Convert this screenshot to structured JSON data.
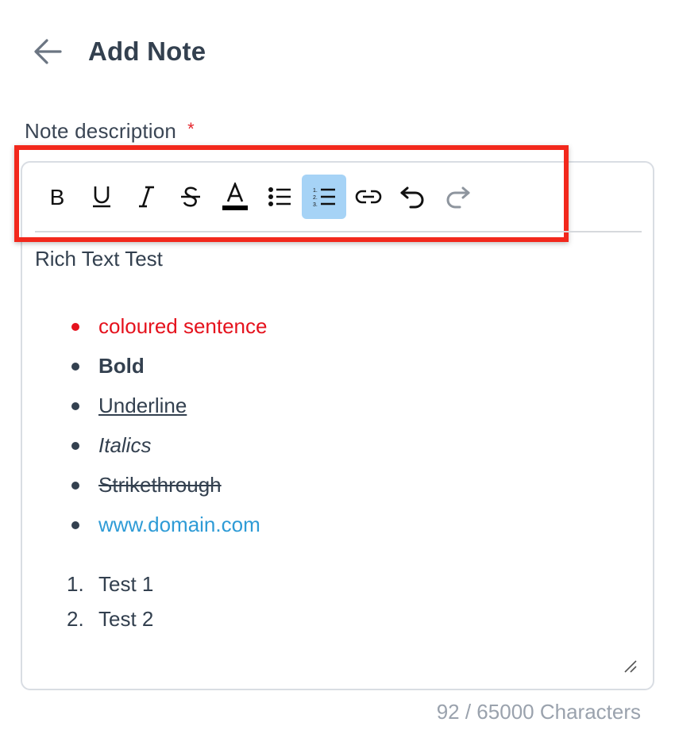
{
  "header": {
    "title": "Add Note",
    "back_icon": "arrow-left-icon"
  },
  "field": {
    "label": "Note description",
    "required_mark": "*"
  },
  "toolbar": {
    "buttons": [
      {
        "name": "bold",
        "icon": "bold-icon",
        "active": false,
        "enabled": true,
        "glyph": "B"
      },
      {
        "name": "underline",
        "icon": "underline-icon",
        "active": false,
        "enabled": true,
        "glyph": "U"
      },
      {
        "name": "italic",
        "icon": "italic-icon",
        "active": false,
        "enabled": true,
        "glyph": "I"
      },
      {
        "name": "strikethrough",
        "icon": "strikethrough-icon",
        "active": false,
        "enabled": true,
        "glyph": "S"
      },
      {
        "name": "text-color",
        "icon": "text-color-icon",
        "active": false,
        "enabled": true,
        "glyph": "A"
      },
      {
        "name": "bullet-list",
        "icon": "bullet-list-icon",
        "active": false,
        "enabled": true
      },
      {
        "name": "numbered-list",
        "icon": "numbered-list-icon",
        "active": true,
        "enabled": true
      },
      {
        "name": "link",
        "icon": "link-icon",
        "active": false,
        "enabled": true
      },
      {
        "name": "undo",
        "icon": "undo-icon",
        "active": false,
        "enabled": true
      },
      {
        "name": "redo",
        "icon": "redo-icon",
        "active": false,
        "enabled": false
      }
    ]
  },
  "content": {
    "intro": "Rich Text Test",
    "bullets": [
      {
        "text": "coloured sentence",
        "style": "red"
      },
      {
        "text": "Bold",
        "style": "bold"
      },
      {
        "text": "Underline",
        "style": "underline"
      },
      {
        "text": "Italics",
        "style": "italic"
      },
      {
        "text": "Strikethrough ",
        "style": "strike"
      },
      {
        "text": "www.domain.com",
        "style": "link"
      }
    ],
    "numbered": [
      {
        "num": "1.",
        "text": "Test 1"
      },
      {
        "num": "2.",
        "text": "Test 2"
      }
    ]
  },
  "footer": {
    "char_count": "92 / 65000 Characters"
  },
  "colors": {
    "accent_active": "#a6d3f6",
    "highlight_box": "#f2281c",
    "red_text": "#e5121d",
    "link_text": "#2e9bd6",
    "body_text": "#33404f"
  }
}
